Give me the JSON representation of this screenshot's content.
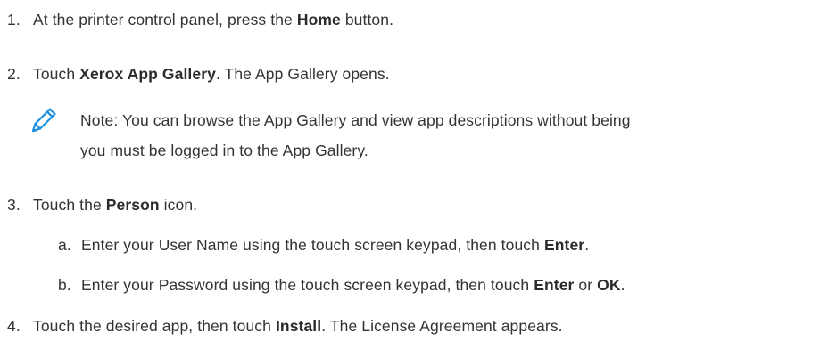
{
  "steps": [
    {
      "number": "1.",
      "parts": [
        "At the printer control panel, press the ",
        "Home",
        " button."
      ]
    },
    {
      "number": "2.",
      "parts": [
        "Touch ",
        "Xerox App Gallery",
        ". The App Gallery opens."
      ]
    },
    {
      "number": "3.",
      "parts": [
        "Touch the ",
        "Person",
        " icon."
      ]
    },
    {
      "number": "4.",
      "parts": [
        "Touch the desired app, then touch ",
        "Install",
        ". The License Agreement appears."
      ]
    }
  ],
  "note": {
    "icon": "pencil-icon",
    "icon_color": "#1a8fe0",
    "line1": "Note: You can browse the App Gallery and view app descriptions without being",
    "line2": "you must be logged in to the App Gallery."
  },
  "substeps": [
    {
      "letter": "a.",
      "parts": [
        "Enter your User Name using the touch screen keypad, then touch ",
        "Enter",
        "."
      ]
    },
    {
      "letter": "b.",
      "parts": [
        "Enter your Password using the touch screen keypad, then touch ",
        "Enter",
        " or ",
        "OK",
        "."
      ]
    }
  ]
}
